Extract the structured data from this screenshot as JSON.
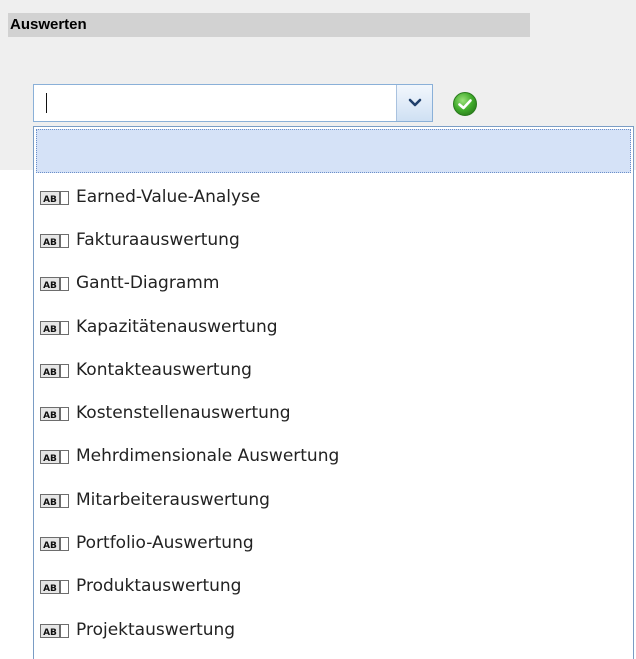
{
  "section": {
    "title": "Auswerten"
  },
  "combo": {
    "value": "",
    "button_icon": "chevron-down-icon",
    "confirm_icon": "green-check-icon"
  },
  "dropdown": {
    "item_icon": "text-field-ab-icon",
    "items": [
      {
        "label": "Earned-Value-Analyse"
      },
      {
        "label": "Fakturaauswertung"
      },
      {
        "label": "Gantt-Diagramm"
      },
      {
        "label": "Kapazitätenauswertung"
      },
      {
        "label": "Kontakteauswertung"
      },
      {
        "label": "Kostenstellenauswertung"
      },
      {
        "label": "Mehrdimensionale Auswertung"
      },
      {
        "label": "Mitarbeiterauswertung"
      },
      {
        "label": "Portfolio-Auswertung"
      },
      {
        "label": "Produktauswertung"
      },
      {
        "label": "Projektauswertung"
      }
    ]
  }
}
